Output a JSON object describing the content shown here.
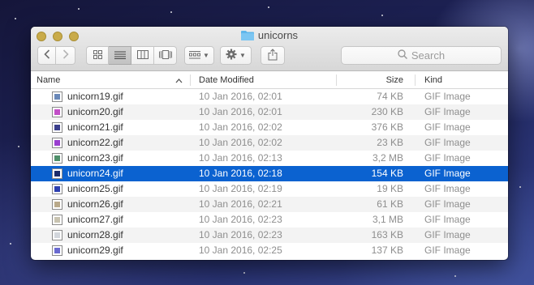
{
  "window": {
    "title": "unicorns",
    "colors": {
      "selection": "#0b62d0",
      "traffic_lights_inactive": "#c9ab4a",
      "folder": "#5fb6ea"
    }
  },
  "toolbar": {
    "back_icon": "chevron-left-icon",
    "forward_icon": "chevron-right-icon",
    "view_modes": [
      "icon-view",
      "list-view",
      "column-view",
      "cover-flow-view"
    ],
    "active_view": "list-view",
    "arrange_icon": "arrange-icon",
    "action_icon": "gear-icon",
    "share_icon": "share-icon",
    "search": {
      "placeholder": "Search"
    }
  },
  "columns": {
    "name": "Name",
    "date": "Date Modified",
    "size": "Size",
    "kind": "Kind"
  },
  "files": [
    {
      "name": "unicorn19.gif",
      "date": "10 Jan 2016, 02:01",
      "size": "74 KB",
      "kind": "GIF Image",
      "thumb": "#6a88b8"
    },
    {
      "name": "unicorn20.gif",
      "date": "10 Jan 2016, 02:01",
      "size": "230 KB",
      "kind": "GIF Image",
      "thumb": "#c24fc7"
    },
    {
      "name": "unicorn21.gif",
      "date": "10 Jan 2016, 02:02",
      "size": "376 KB",
      "kind": "GIF Image",
      "thumb": "#3b3f8c"
    },
    {
      "name": "unicorn22.gif",
      "date": "10 Jan 2016, 02:02",
      "size": "23 KB",
      "kind": "GIF Image",
      "thumb": "#9a3fd0"
    },
    {
      "name": "unicorn23.gif",
      "date": "10 Jan 2016, 02:13",
      "size": "3,2 MB",
      "kind": "GIF Image",
      "thumb": "#4f8f6a"
    },
    {
      "name": "unicorn24.gif",
      "date": "10 Jan 2016, 02:18",
      "size": "154 KB",
      "kind": "GIF Image",
      "thumb": "#1c2c6a",
      "selected": true
    },
    {
      "name": "unicorn25.gif",
      "date": "10 Jan 2016, 02:19",
      "size": "19 KB",
      "kind": "GIF Image",
      "thumb": "#2c3fb0"
    },
    {
      "name": "unicorn26.gif",
      "date": "10 Jan 2016, 02:21",
      "size": "61 KB",
      "kind": "GIF Image",
      "thumb": "#b9a98a"
    },
    {
      "name": "unicorn27.gif",
      "date": "10 Jan 2016, 02:23",
      "size": "3,1 MB",
      "kind": "GIF Image",
      "thumb": "#c8c3b0"
    },
    {
      "name": "unicorn28.gif",
      "date": "10 Jan 2016, 02:23",
      "size": "163 KB",
      "kind": "GIF Image",
      "thumb": "#d2d6dc"
    },
    {
      "name": "unicorn29.gif",
      "date": "10 Jan 2016, 02:25",
      "size": "137 KB",
      "kind": "GIF Image",
      "thumb": "#6a6ad0"
    }
  ]
}
